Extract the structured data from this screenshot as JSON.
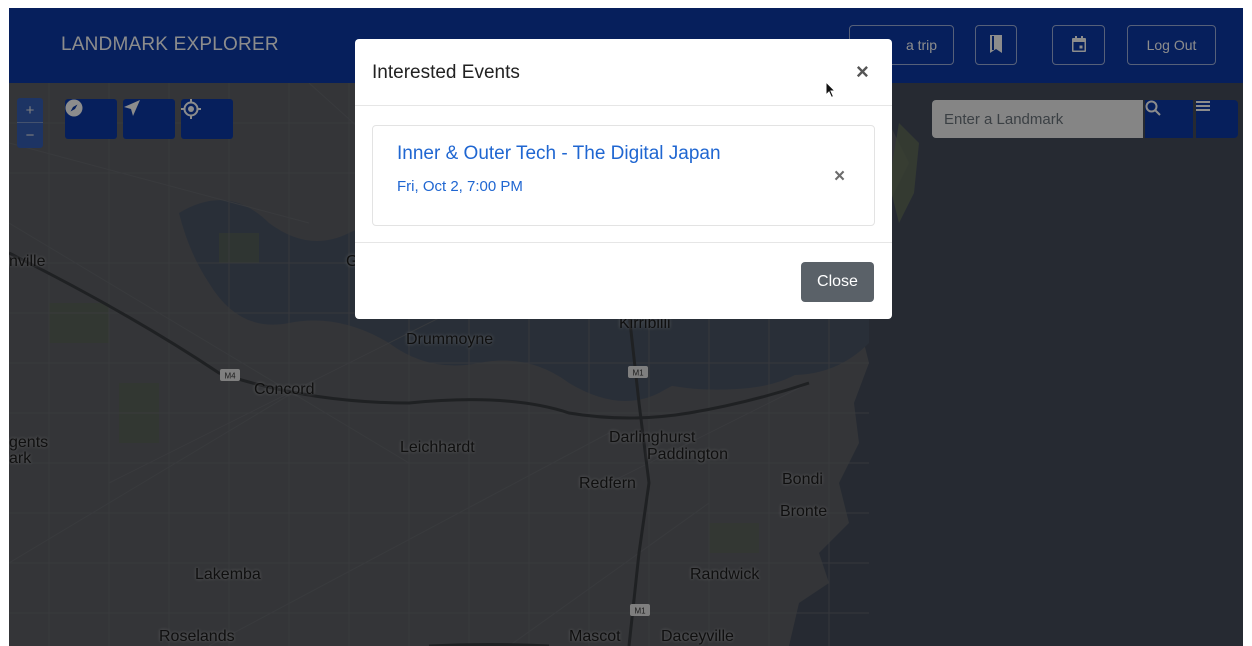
{
  "navbar": {
    "brand": "LANDMARK EXPLORER",
    "plan_trip_label": "a trip",
    "logout_label": "Log Out",
    "bookmark_icon": "bookmark-icon",
    "calendar_icon": "calendar-icon"
  },
  "map": {
    "zoom_in_label": "+",
    "zoom_out_label": "−",
    "tools": [
      "compass-icon",
      "navigate-arrow-icon",
      "locate-crosshair-icon"
    ],
    "search": {
      "placeholder": "Enter a Landmark"
    },
    "places": [
      {
        "name": "nville",
        "id": "place-nville"
      },
      {
        "name": "G",
        "id": "place-g"
      },
      {
        "name": "Drummoyne",
        "id": "place-drummoyne"
      },
      {
        "name": "Kirribilli",
        "id": "place-kirribilli"
      },
      {
        "name": "Concord",
        "id": "place-concord"
      },
      {
        "name": "gents",
        "id": "place-gents"
      },
      {
        "name": "ark",
        "id": "place-ark"
      },
      {
        "name": "Leichhardt",
        "id": "place-leichhardt"
      },
      {
        "name": "Darlinghurst",
        "id": "place-darlinghurst"
      },
      {
        "name": "Paddington",
        "id": "place-paddington"
      },
      {
        "name": "Redfern",
        "id": "place-redfern"
      },
      {
        "name": "Bondi",
        "id": "place-bondi"
      },
      {
        "name": "Bronte",
        "id": "place-bronte"
      },
      {
        "name": "Lakemba",
        "id": "place-lakemba"
      },
      {
        "name": "Randwick",
        "id": "place-randwick"
      },
      {
        "name": "Roselands",
        "id": "place-roselands"
      },
      {
        "name": "Mascot",
        "id": "place-mascot"
      },
      {
        "name": "Daceyville",
        "id": "place-daceyville"
      }
    ],
    "road_shields": [
      "M4",
      "M1",
      "M1"
    ]
  },
  "modal": {
    "title": "Interested Events",
    "close_x": "×",
    "events": [
      {
        "title": "Inner & Outer Tech - The Digital Japan",
        "date": "Fri, Oct 2, 7:00 PM",
        "remove": "×"
      }
    ],
    "close_button": "Close"
  },
  "colors": {
    "primary": "#0b3aa8",
    "link": "#1f66d1",
    "secondary_button": "#5a6168"
  }
}
